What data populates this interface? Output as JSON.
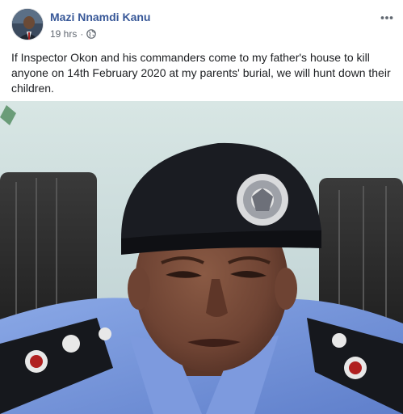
{
  "post": {
    "author": "Mazi Nnamdi Kanu",
    "timestamp": "19 hrs",
    "separator": "·",
    "privacy_icon": "globe-icon",
    "more_icon": "more-options-icon",
    "text": "If Inspector Okon and his commanders come to my father's house to kill anyone on 14th February 2020 at my parents' burial, we will hunt down their children."
  },
  "colors": {
    "author_link": "#385898",
    "meta_text": "#606770",
    "body_text": "#1c1e21",
    "uniform_blue": "#6f8fd6",
    "beret": "#1a1c22"
  }
}
